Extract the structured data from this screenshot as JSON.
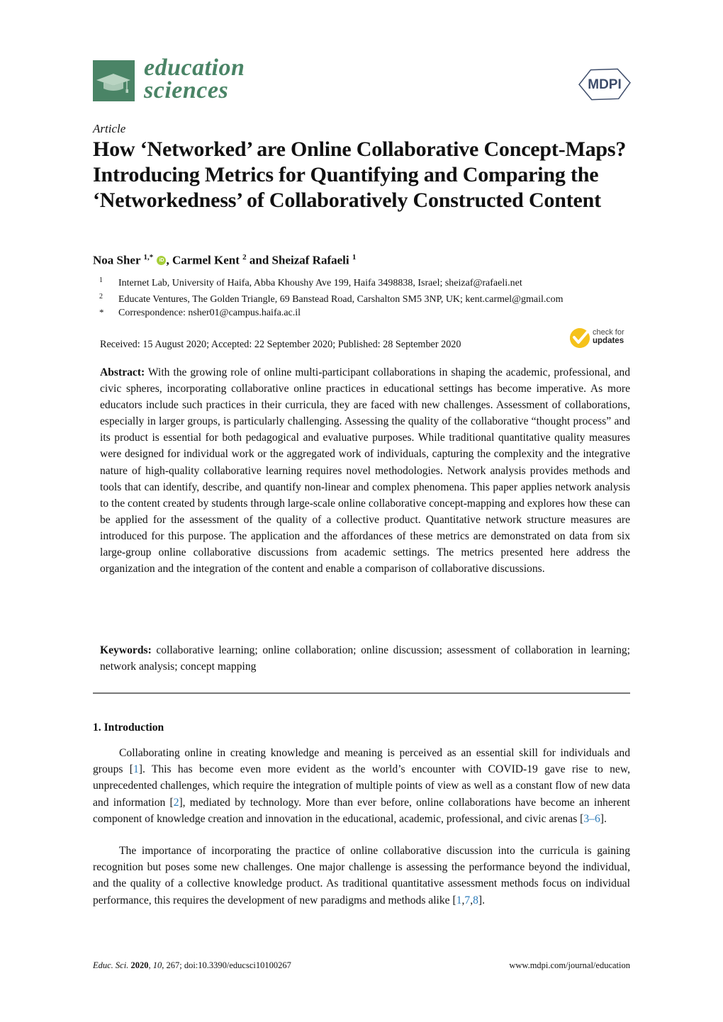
{
  "header": {
    "journal_line1": "education",
    "journal_line2": "sciences",
    "publisher_logo_text": "MDPI",
    "brand_color": "#4a8466"
  },
  "article": {
    "type": "Article",
    "title": "How ‘Networked’ are Online Collaborative Concept-Maps? Introducing Metrics for Quantifying and Comparing the ‘Networkedness’ of Collaboratively Constructed Content",
    "authors": [
      {
        "name": "Noa Sher",
        "sup": "1,*",
        "orcid": true
      },
      {
        "name": "Carmel Kent",
        "sup": "2"
      },
      {
        "name": "Sheizaf Rafaeli",
        "sup": "1"
      }
    ],
    "author_separators": [
      ", ",
      " and "
    ],
    "affiliations": [
      {
        "mark": "1",
        "text": "Internet Lab, University of Haifa, Abba Khoushy Ave 199, Haifa 3498838, Israel; sheizaf@rafaeli.net"
      },
      {
        "mark": "2",
        "text": "Educate Ventures, The Golden Triangle, 69 Banstead Road, Carshalton SM5 3NP, UK; kent.carmel@gmail.com"
      },
      {
        "mark": "*",
        "text": "Correspondence: nsher01@campus.haifa.ac.il"
      }
    ],
    "dates": "Received: 15 August 2020; Accepted: 22 September 2020; Published: 28 September 2020",
    "check_updates": {
      "line1": "check for",
      "line2": "updates"
    },
    "abstract_label": "Abstract:",
    "abstract": "With the growing role of online multi-participant collaborations in shaping the academic, professional, and civic spheres, incorporating collaborative online practices in educational settings has become imperative. As more educators include such practices in their curricula, they are faced with new challenges. Assessment of collaborations, especially in larger groups, is particularly challenging. Assessing the quality of the collaborative “thought process” and its product is essential for both pedagogical and evaluative purposes. While traditional quantitative quality measures were designed for individual work or the aggregated work of individuals, capturing the complexity and the integrative nature of high-quality collaborative learning requires novel methodologies. Network analysis provides methods and tools that can identify, describe, and quantify non-linear and complex phenomena. This paper applies network analysis to the content created by students through large-scale online collaborative concept-mapping and explores how these can be applied for the assessment of the quality of a collective product. Quantitative network structure measures are introduced for this purpose. The application and the affordances of these metrics are demonstrated on data from six large-group online collaborative discussions from academic settings. The metrics presented here address the organization and the integration of the content and enable a comparison of collaborative discussions.",
    "keywords_label": "Keywords:",
    "keywords": "collaborative learning; online collaboration; online discussion; assessment of collaboration in learning; network analysis; concept mapping"
  },
  "section1": {
    "heading": "1. Introduction",
    "p1": [
      {
        "t": "Collaborating online in creating knowledge and meaning is perceived as an essential skill for individuals and groups ["
      },
      {
        "c": "1"
      },
      {
        "t": "].  This has become even more evident as the world’s encounter with COVID-19 gave rise to new, unprecedented challenges, which require the integration of multiple points of view as well as a constant flow of new data and information ["
      },
      {
        "c": "2"
      },
      {
        "t": "], mediated by technology. More than ever before, online collaborations have become an inherent component of knowledge creation and innovation in the educational, academic, professional, and civic arenas ["
      },
      {
        "c": "3–6"
      },
      {
        "t": "]."
      }
    ],
    "p2": [
      {
        "t": "The importance of incorporating the practice of online collaborative discussion into the curricula is gaining recognition but poses some new challenges. One major challenge is assessing the performance beyond the individual, and the quality of a collective knowledge product. As traditional quantitative assessment methods focus on individual performance, this requires the development of new paradigms and methods alike ["
      },
      {
        "c": "1"
      },
      {
        "t": ","
      },
      {
        "c": "7"
      },
      {
        "t": ","
      },
      {
        "c": "8"
      },
      {
        "t": "]."
      }
    ]
  },
  "footer": {
    "journal_abbrev": "Educ. Sci.",
    "year": "2020",
    "volume": "10",
    "rest": ", 267; doi:10.3390/educsci10100267",
    "url": "www.mdpi.com/journal/education"
  }
}
